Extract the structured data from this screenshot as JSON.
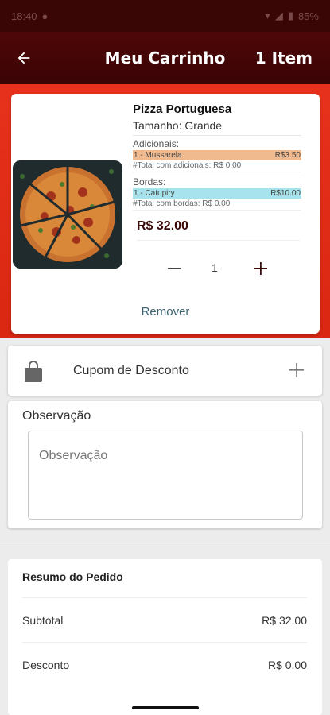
{
  "status_bar": {
    "time": "18:40",
    "battery": "85%"
  },
  "app_bar": {
    "title": "Meu Carrinho",
    "item_count": "1 Item"
  },
  "cart_item": {
    "name": "Pizza Portuguesa",
    "size": "Tamanho: Grande",
    "additions_label": "Adicionais:",
    "addition": {
      "name": "1 - Mussarela",
      "price": "R$3.50"
    },
    "additions_total": "#Total com adicionais: R$ 0.00",
    "borders_label": "Bordas:",
    "border": {
      "name": "1 - Catupiry",
      "price": "R$10.00"
    },
    "borders_total": "#Total com bordas: R$ 0.00",
    "price": "R$ 32.00",
    "quantity": "1",
    "remove_label": "Remover"
  },
  "coupon": {
    "label": "Cupom de Desconto"
  },
  "observation": {
    "title": "Observação",
    "placeholder": "Observação",
    "value": ""
  },
  "summary": {
    "title": "Resumo do Pedido",
    "rows": [
      {
        "label": "Subtotal",
        "value": "R$ 32.00"
      },
      {
        "label": "Desconto",
        "value": "R$ 0.00"
      }
    ]
  },
  "colors": {
    "app_bar": "#4e0708",
    "accent_red": "#e7321c",
    "addition_highlight": "#f0b98e",
    "border_highlight": "#a6e3ec",
    "remove_link": "#3b6472"
  }
}
